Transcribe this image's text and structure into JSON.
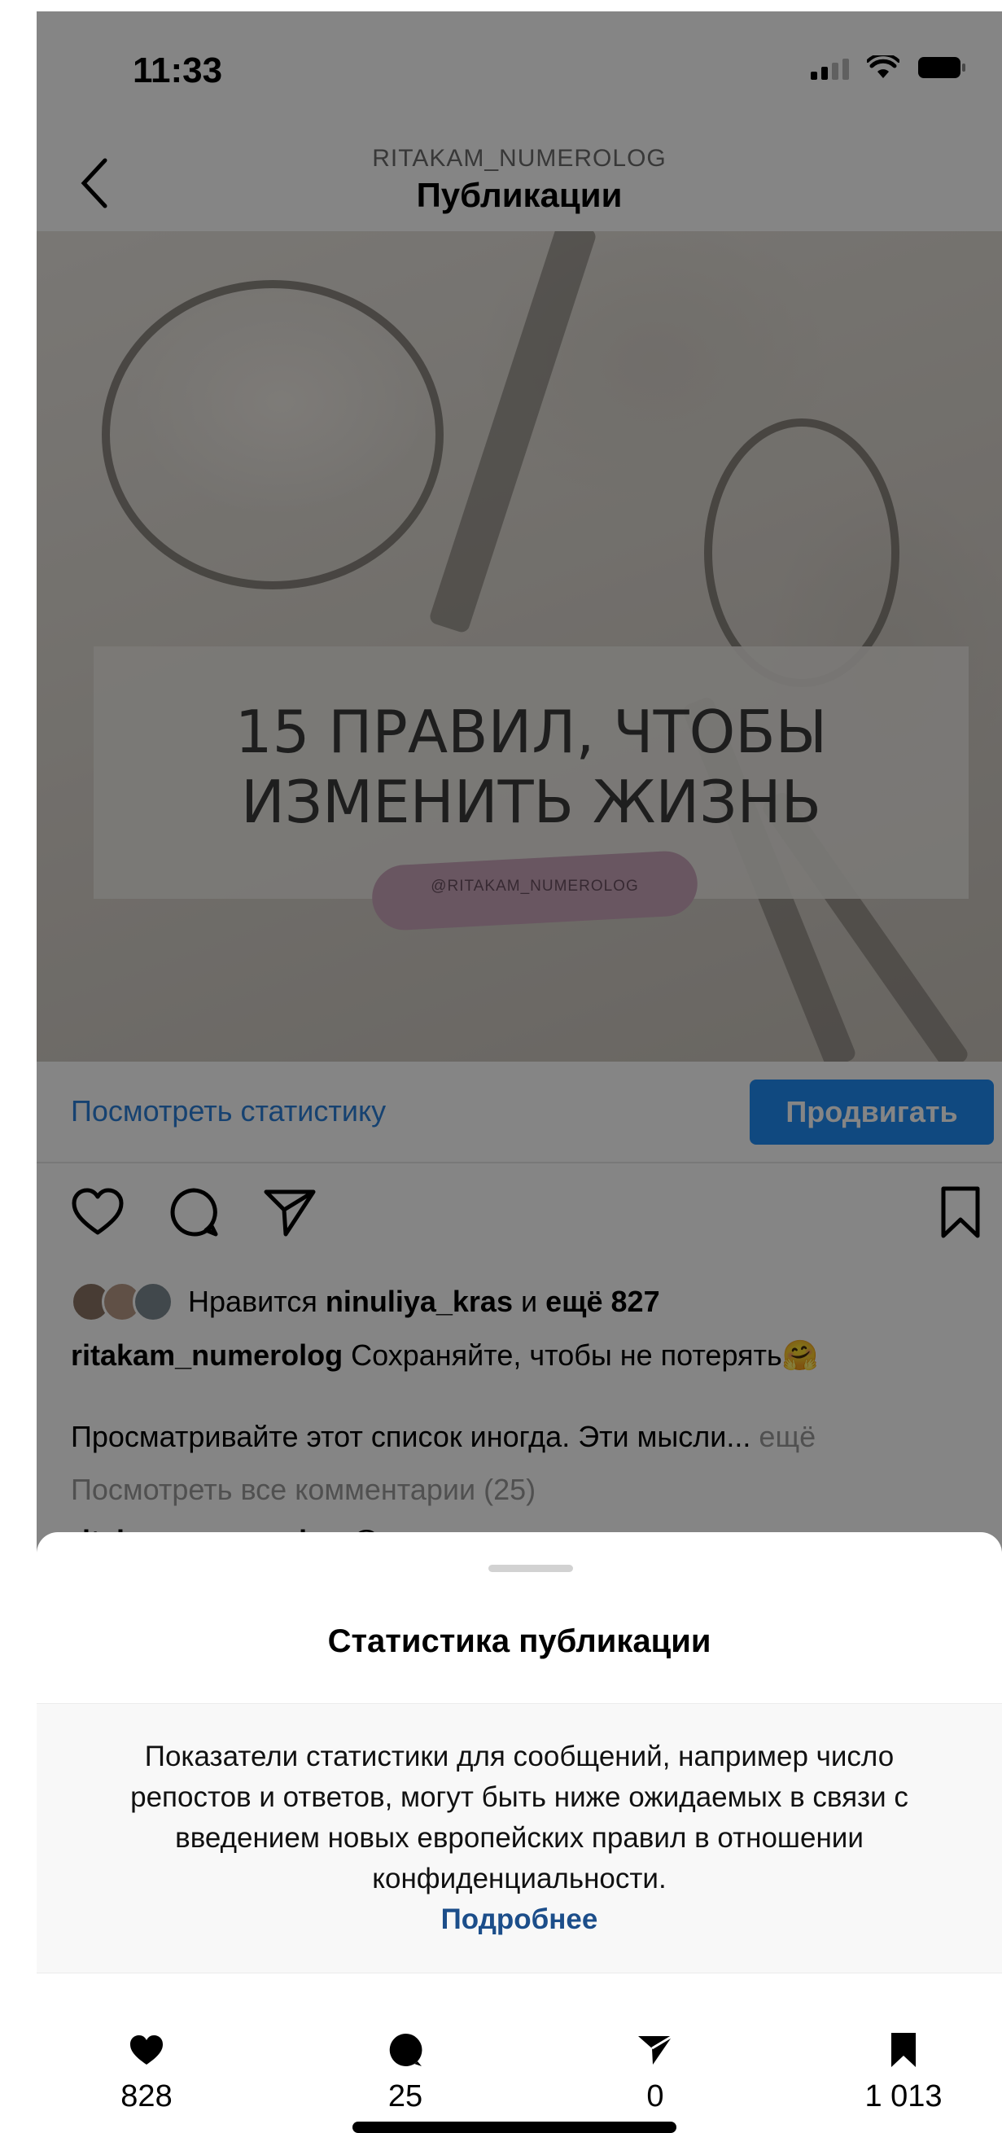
{
  "status_bar": {
    "time": "11:33"
  },
  "nav": {
    "account": "RITAKAM_NUMEROLOG",
    "title": "Публикации"
  },
  "post": {
    "banner_line1": "15 ПРАВИЛ, ЧТОБЫ",
    "banner_line2": "ИЗМЕНИТЬ ЖИЗНЬ",
    "watermark": "@RITAKAM_NUMEROLOG",
    "view_stats": "Посмотреть статистику",
    "promote": "Продвигать",
    "likes_prefix": "Нравится ",
    "likes_user": "ninuliya_kras",
    "likes_and": " и ",
    "likes_more": "ещё 827",
    "caption_user": "ritakam_numerolog",
    "caption_text": " Сохраняйте, чтобы не потерять🤗",
    "caption_line2": "Просматривайте этот список иногда. Эти мысли...",
    "caption_more": " ещё",
    "view_comments": "Посмотреть все комментарии (25)",
    "cut_comment": "ritakam_numerolog @"
  },
  "sheet": {
    "title": "Статистика публикации",
    "notice": "Показатели статистики для сообщений, например число репостов и ответов, могут быть ниже ожидаемых в связи с введением новых европейских правил в отношении конфиденциальности.",
    "learn_more": "Подробнее",
    "metrics": [
      {
        "icon": "heart-icon",
        "value": "828"
      },
      {
        "icon": "comment-icon",
        "value": "25"
      },
      {
        "icon": "share-icon",
        "value": "0"
      },
      {
        "icon": "bookmark-icon",
        "value": "1 013"
      }
    ]
  },
  "colors": {
    "link": "#2b7fd8",
    "promote": "#1f8df5",
    "learn_more": "#1c4e8a"
  }
}
